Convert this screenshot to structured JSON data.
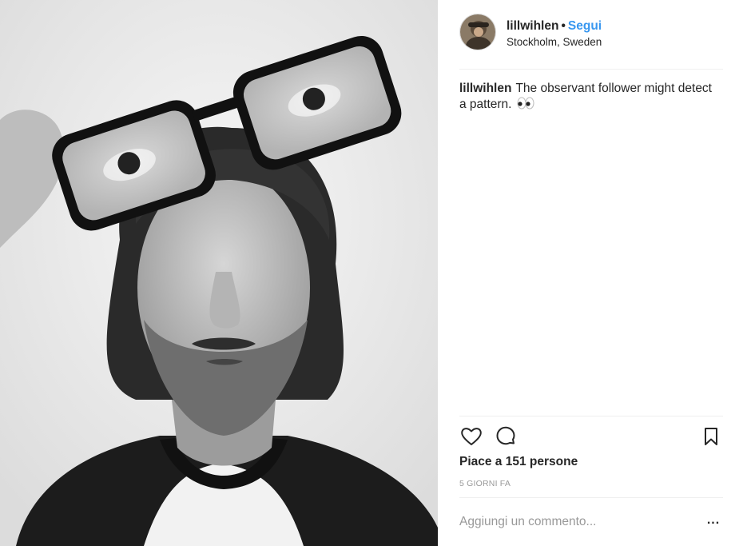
{
  "post": {
    "username": "lillwihlen",
    "separator": "•",
    "follow_label": "Segui",
    "location": "Stockholm, Sweden",
    "caption_user": "lillwihlen",
    "caption_text": "The observant follower might detect a pattern.",
    "caption_emoji": "eyes-emoji",
    "likes_text": "Piace a 151 persone",
    "time_text": "5 GIORNI FA",
    "comment_placeholder": "Aggiungi un commento...",
    "more_label": "...",
    "icons": {
      "like": "heart-icon",
      "comment": "comment-icon",
      "save": "bookmark-icon",
      "more": "more-options-icon"
    },
    "colors": {
      "follow": "#3897f0",
      "text": "#262626",
      "muted": "#999999",
      "divider": "#efefef"
    }
  }
}
